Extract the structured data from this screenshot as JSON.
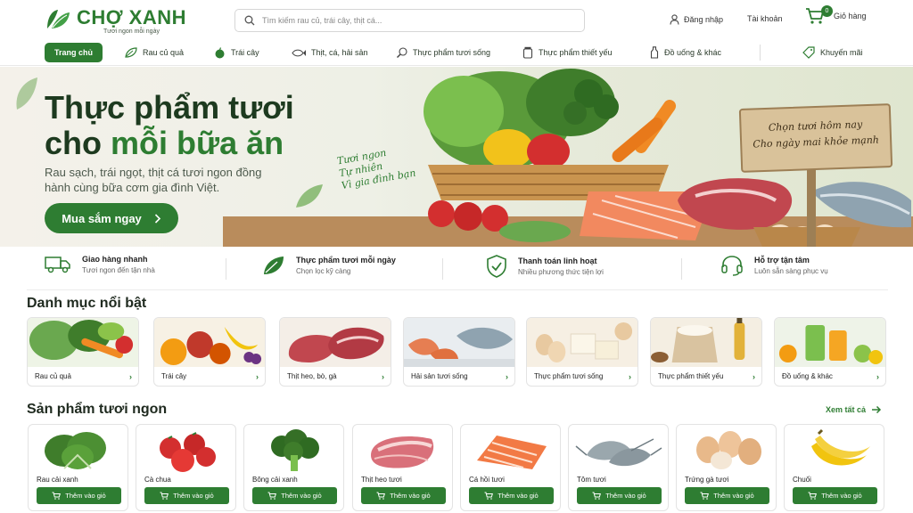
{
  "header": {
    "logo_name": "CHỢ XANH",
    "logo_tagline": "Tươi ngon mỗi ngày",
    "search_placeholder": "Tìm kiếm rau củ, trái cây, thịt cá...",
    "login": "Đăng nhập",
    "account": "Tài khoản",
    "cart_count": "0",
    "cart": "Giỏ hàng"
  },
  "nav": {
    "items": [
      "Trang chủ",
      "Rau củ quả",
      "Trái cây",
      "Thịt, cá, hải sản",
      "Thực phẩm tươi sống",
      "Thực phẩm thiết yếu",
      "Đồ uống & khác",
      "Khuyến mãi"
    ]
  },
  "hero": {
    "title_line1": "Thực phẩm tươi",
    "title_line2_prefix": "cho ",
    "title_line2_accent": "mỗi bữa ăn",
    "subtitle": "Rau sạch, trái ngọt, thịt cá tươi ngon đồng hành cùng bữa cơm gia đình Việt.",
    "cta": "Mua sắm ngay",
    "script_lines": [
      "Tươi ngon",
      "Tự nhiên",
      "Vì gia đình bạn"
    ],
    "sign_lines": [
      "Chọn tươi hôm nay",
      "Cho ngày mai khỏe mạnh"
    ]
  },
  "features": [
    {
      "title": "Giao hàng nhanh",
      "sub": "Tươi ngon đến tận nhà",
      "icon": "truck-icon"
    },
    {
      "title": "Thực phẩm tươi mỗi ngày",
      "sub": "Chọn lọc kỹ càng",
      "icon": "leaf-icon"
    },
    {
      "title": "Thanh toán linh hoạt",
      "sub": "Nhiều phương thức tiện lợi",
      "icon": "shield-check-icon"
    },
    {
      "title": "Hỗ trợ tận tâm",
      "sub": "Luôn sẵn sàng phục vụ",
      "icon": "headset-icon"
    }
  ],
  "categories_title": "Danh mục nổi bật",
  "categories": [
    "Rau củ quả",
    "Trái cây",
    "Thịt heo, bò, gà",
    "Hải sản tươi sống",
    "Thực phẩm tươi sống",
    "Thực phẩm thiết yếu",
    "Đồ uống & khác"
  ],
  "products_title": "Sản phẩm tươi ngon",
  "see_all": "Xem tất cả",
  "add_to_cart": "Thêm vào giỏ",
  "products": [
    "Rau cải xanh",
    "Cà chua",
    "Bông cải xanh",
    "Thịt heo tươi",
    "Cá hồi tươi",
    "Tôm tươi",
    "Trứng gà tươi",
    "Chuối"
  ],
  "colors": {
    "brand": "#2e7d32",
    "title": "#1d3a1f"
  }
}
